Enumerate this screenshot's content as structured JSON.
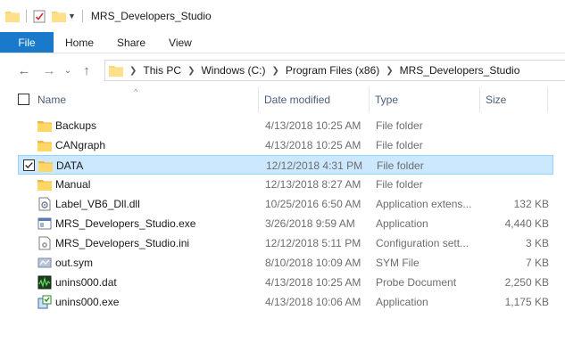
{
  "window": {
    "title": "MRS_Developers_Studio"
  },
  "ribbon": {
    "tabs": [
      "File",
      "Home",
      "Share",
      "View"
    ]
  },
  "address": {
    "crumbs": [
      "This PC",
      "Windows (C:)",
      "Program Files (x86)",
      "MRS_Developers_Studio"
    ]
  },
  "columns": {
    "name": "Name",
    "date": "Date modified",
    "type": "Type",
    "size": "Size"
  },
  "files": [
    {
      "name": "Backups",
      "date": "4/13/2018 10:25 AM",
      "type": "File folder",
      "size": "",
      "icon": "folder-icon"
    },
    {
      "name": "CANgraph",
      "date": "4/13/2018 10:25 AM",
      "type": "File folder",
      "size": "",
      "icon": "folder-icon"
    },
    {
      "name": "DATA",
      "date": "12/12/2018 4:31 PM",
      "type": "File folder",
      "size": "",
      "icon": "folder-icon",
      "selected": true
    },
    {
      "name": "Manual",
      "date": "12/13/2018 8:27 AM",
      "type": "File folder",
      "size": "",
      "icon": "folder-icon"
    },
    {
      "name": "Label_VB6_Dll.dll",
      "date": "10/25/2016 6:50 AM",
      "type": "Application extens...",
      "size": "132 KB",
      "icon": "dll-file-icon"
    },
    {
      "name": "MRS_Developers_Studio.exe",
      "date": "3/26/2018 9:59 AM",
      "type": "Application",
      "size": "4,440 KB",
      "icon": "app-icon"
    },
    {
      "name": "MRS_Developers_Studio.ini",
      "date": "12/12/2018 5:11 PM",
      "type": "Configuration sett...",
      "size": "3 KB",
      "icon": "ini-file-icon"
    },
    {
      "name": "out.sym",
      "date": "8/10/2018 10:09 AM",
      "type": "SYM File",
      "size": "7 KB",
      "icon": "sym-file-icon"
    },
    {
      "name": "unins000.dat",
      "date": "4/13/2018 10:25 AM",
      "type": "Probe Document",
      "size": "2,250 KB",
      "icon": "probe-document-icon"
    },
    {
      "name": "unins000.exe",
      "date": "4/13/2018 10:06 AM",
      "type": "Application",
      "size": "1,175 KB",
      "icon": "installer-icon"
    }
  ]
}
